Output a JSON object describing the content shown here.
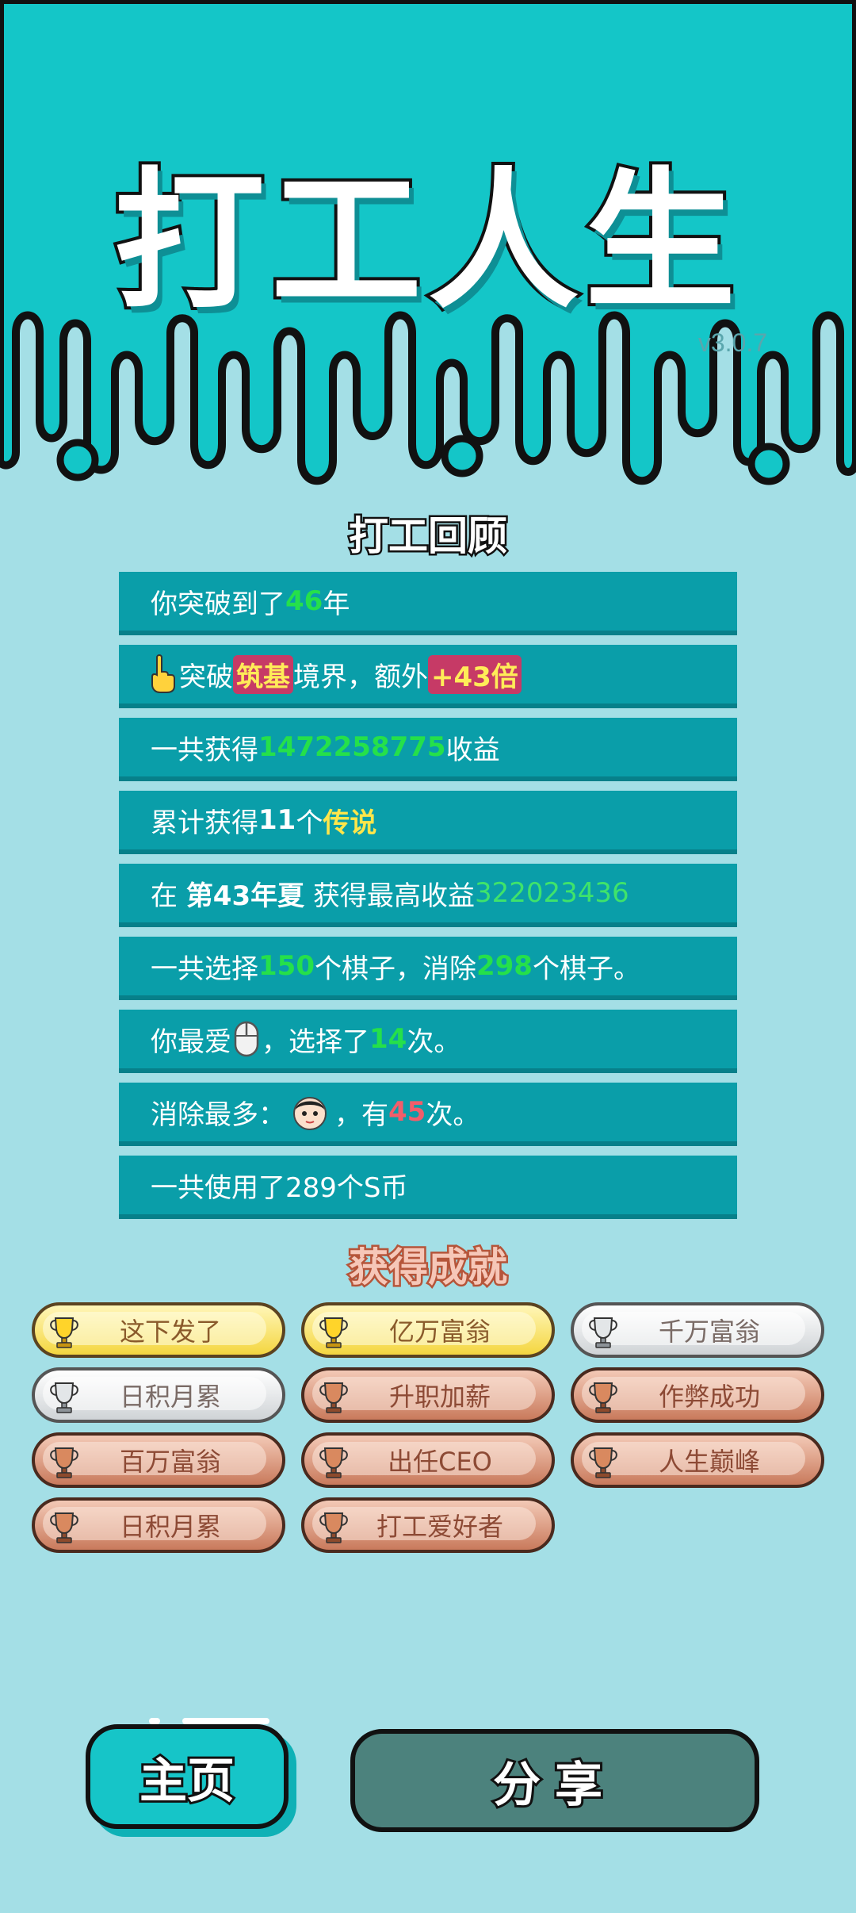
{
  "header": {
    "title": "打工人生",
    "version": "v3.0.7"
  },
  "review": {
    "title": "打工回顾",
    "row1": {
      "prefix": "你突破到了",
      "years": "46",
      "suffix": "年"
    },
    "row2": {
      "prefix": "突破",
      "realm": "筑基",
      "middle": "境界，额外",
      "bonus": "+43倍"
    },
    "row3": {
      "prefix": "一共获得",
      "income": "1472258775",
      "suffix": "收益"
    },
    "row4": {
      "prefix": "累计获得",
      "count": "11",
      "middle": "个",
      "rarity": "传说"
    },
    "row5": {
      "prefix": "在",
      "when": "第43年夏",
      "middle": "获得最高收益",
      "best": "322023436"
    },
    "row6": {
      "prefix": "一共选择",
      "chosen": "150",
      "middle": "个棋子，消除",
      "removed": "298",
      "suffix": "个棋子。"
    },
    "row7": {
      "prefix": "你最爱",
      "middle": "，选择了",
      "times": "14",
      "suffix": "次。"
    },
    "row8": {
      "prefix": "消除最多：",
      "middle": "，有",
      "times": "45",
      "suffix": "次。"
    },
    "row9": {
      "text": "一共使用了289个S币"
    }
  },
  "achievements": {
    "title": "获得成就",
    "items": [
      {
        "label": "这下发了",
        "tier": "gold"
      },
      {
        "label": "亿万富翁",
        "tier": "gold"
      },
      {
        "label": "千万富翁",
        "tier": "silver"
      },
      {
        "label": "日积月累",
        "tier": "silver"
      },
      {
        "label": "升职加薪",
        "tier": "bronze"
      },
      {
        "label": "作弊成功",
        "tier": "bronze"
      },
      {
        "label": "百万富翁",
        "tier": "bronze"
      },
      {
        "label": "出任CEO",
        "tier": "bronze"
      },
      {
        "label": "人生巅峰",
        "tier": "bronze"
      },
      {
        "label": "日积月累",
        "tier": "bronze"
      },
      {
        "label": "打工爱好者",
        "tier": "bronze"
      }
    ]
  },
  "buttons": {
    "home": "主页",
    "share": "分享"
  },
  "icons": {
    "row2": "pointing-hand-icon",
    "row7": "mouse-icon",
    "row8": "face-icon",
    "achievement": "trophy-icon"
  },
  "colors": {
    "header": "#14c6c8",
    "background": "#a4dfe6",
    "row": "#0a9ea9",
    "highlight_green": "#25e04a",
    "highlight_red": "#f25d6a",
    "highlight_yellow": "#ffe64a"
  }
}
